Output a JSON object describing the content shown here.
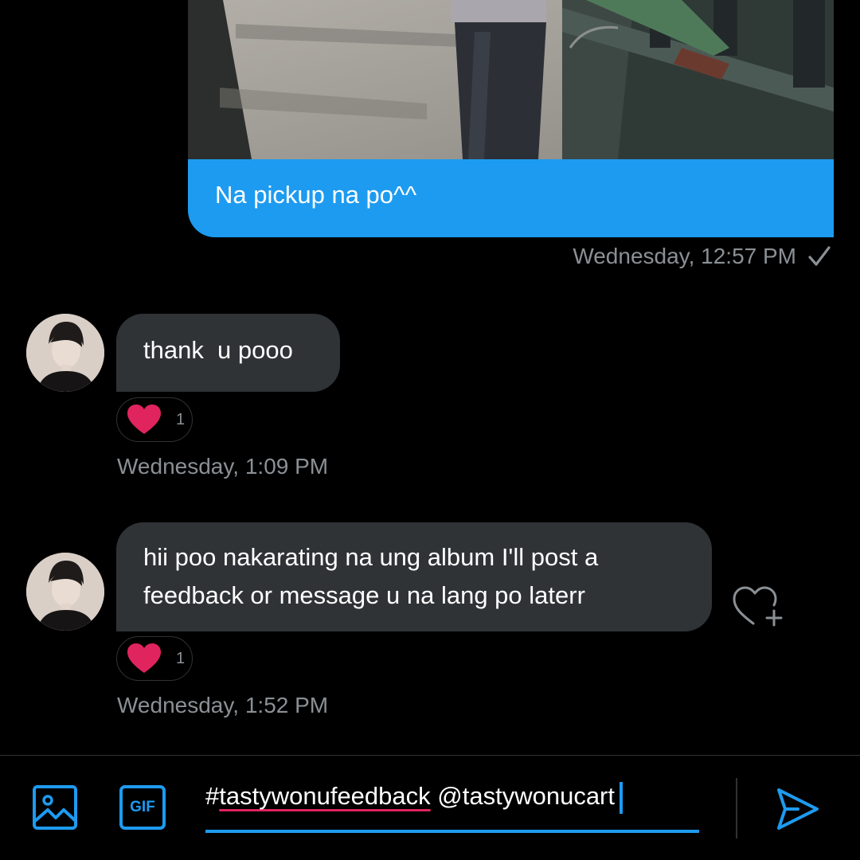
{
  "colors": {
    "accent": "#1d9bf0",
    "background": "#000000",
    "incoming_bubble": "#2f3336",
    "heart": "#f91880",
    "muted_text": "#8b9095",
    "spellcheck_underline": "#e0245e"
  },
  "messages": [
    {
      "direction": "outgoing",
      "attachment": "photo",
      "text": "Na pickup na po^^",
      "timestamp": "Wednesday, 12:57 PM",
      "status_icon": "check-icon"
    },
    {
      "direction": "incoming",
      "text": "thank  u pooo",
      "reaction": {
        "icon": "heart-icon",
        "count": "1"
      },
      "timestamp": "Wednesday, 1:09 PM"
    },
    {
      "direction": "incoming",
      "text_lines": [
        "hii poo nakarating na ung album I'll post a",
        "feedback or message u na lang po laterr"
      ],
      "reaction": {
        "icon": "heart-icon",
        "count": "1"
      },
      "timestamp": "Wednesday, 1:52 PM",
      "action_icon": "add-reaction-icon"
    }
  ],
  "composer": {
    "value": {
      "prefix": "#",
      "hashtag": "tastywonufeedback",
      "mention": " @tastywonucart"
    },
    "media_icon": "image-icon",
    "gif_label": "GIF",
    "send_icon": "send-icon"
  }
}
